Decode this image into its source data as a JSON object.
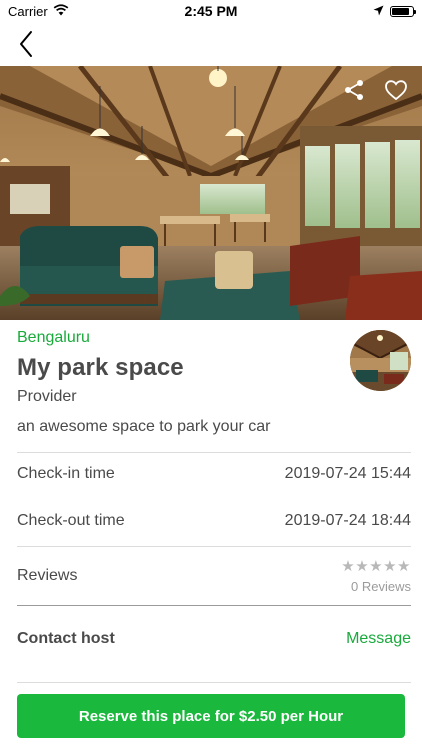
{
  "status_bar": {
    "carrier": "Carrier",
    "time": "2:45 PM",
    "battery_level": 0.85
  },
  "nav": {
    "back_icon": "chevron-left-icon"
  },
  "hero": {
    "share_icon": "share-icon",
    "favorite_icon": "heart-outline-icon"
  },
  "listing": {
    "city": "Bengaluru",
    "title": "My park space",
    "role": "Provider",
    "description": "an awesome space to park your car"
  },
  "details": {
    "checkin_label": "Check-in time",
    "checkin_value": "2019-07-24 15:44",
    "checkout_label": "Check-out time",
    "checkout_value": "2019-07-24 18:44"
  },
  "reviews": {
    "label": "Reviews",
    "stars": "★★★★★",
    "rating": 0,
    "count_text": "0 Reviews"
  },
  "contact": {
    "label": "Contact host",
    "message_label": "Message"
  },
  "reserve": {
    "label": "Reserve this place for $2.50 per Hour"
  },
  "colors": {
    "accent_green": "#1aaa3c",
    "button_green": "#1ab83c",
    "text": "#4a4a4a",
    "divider": "#dcdcdc"
  }
}
